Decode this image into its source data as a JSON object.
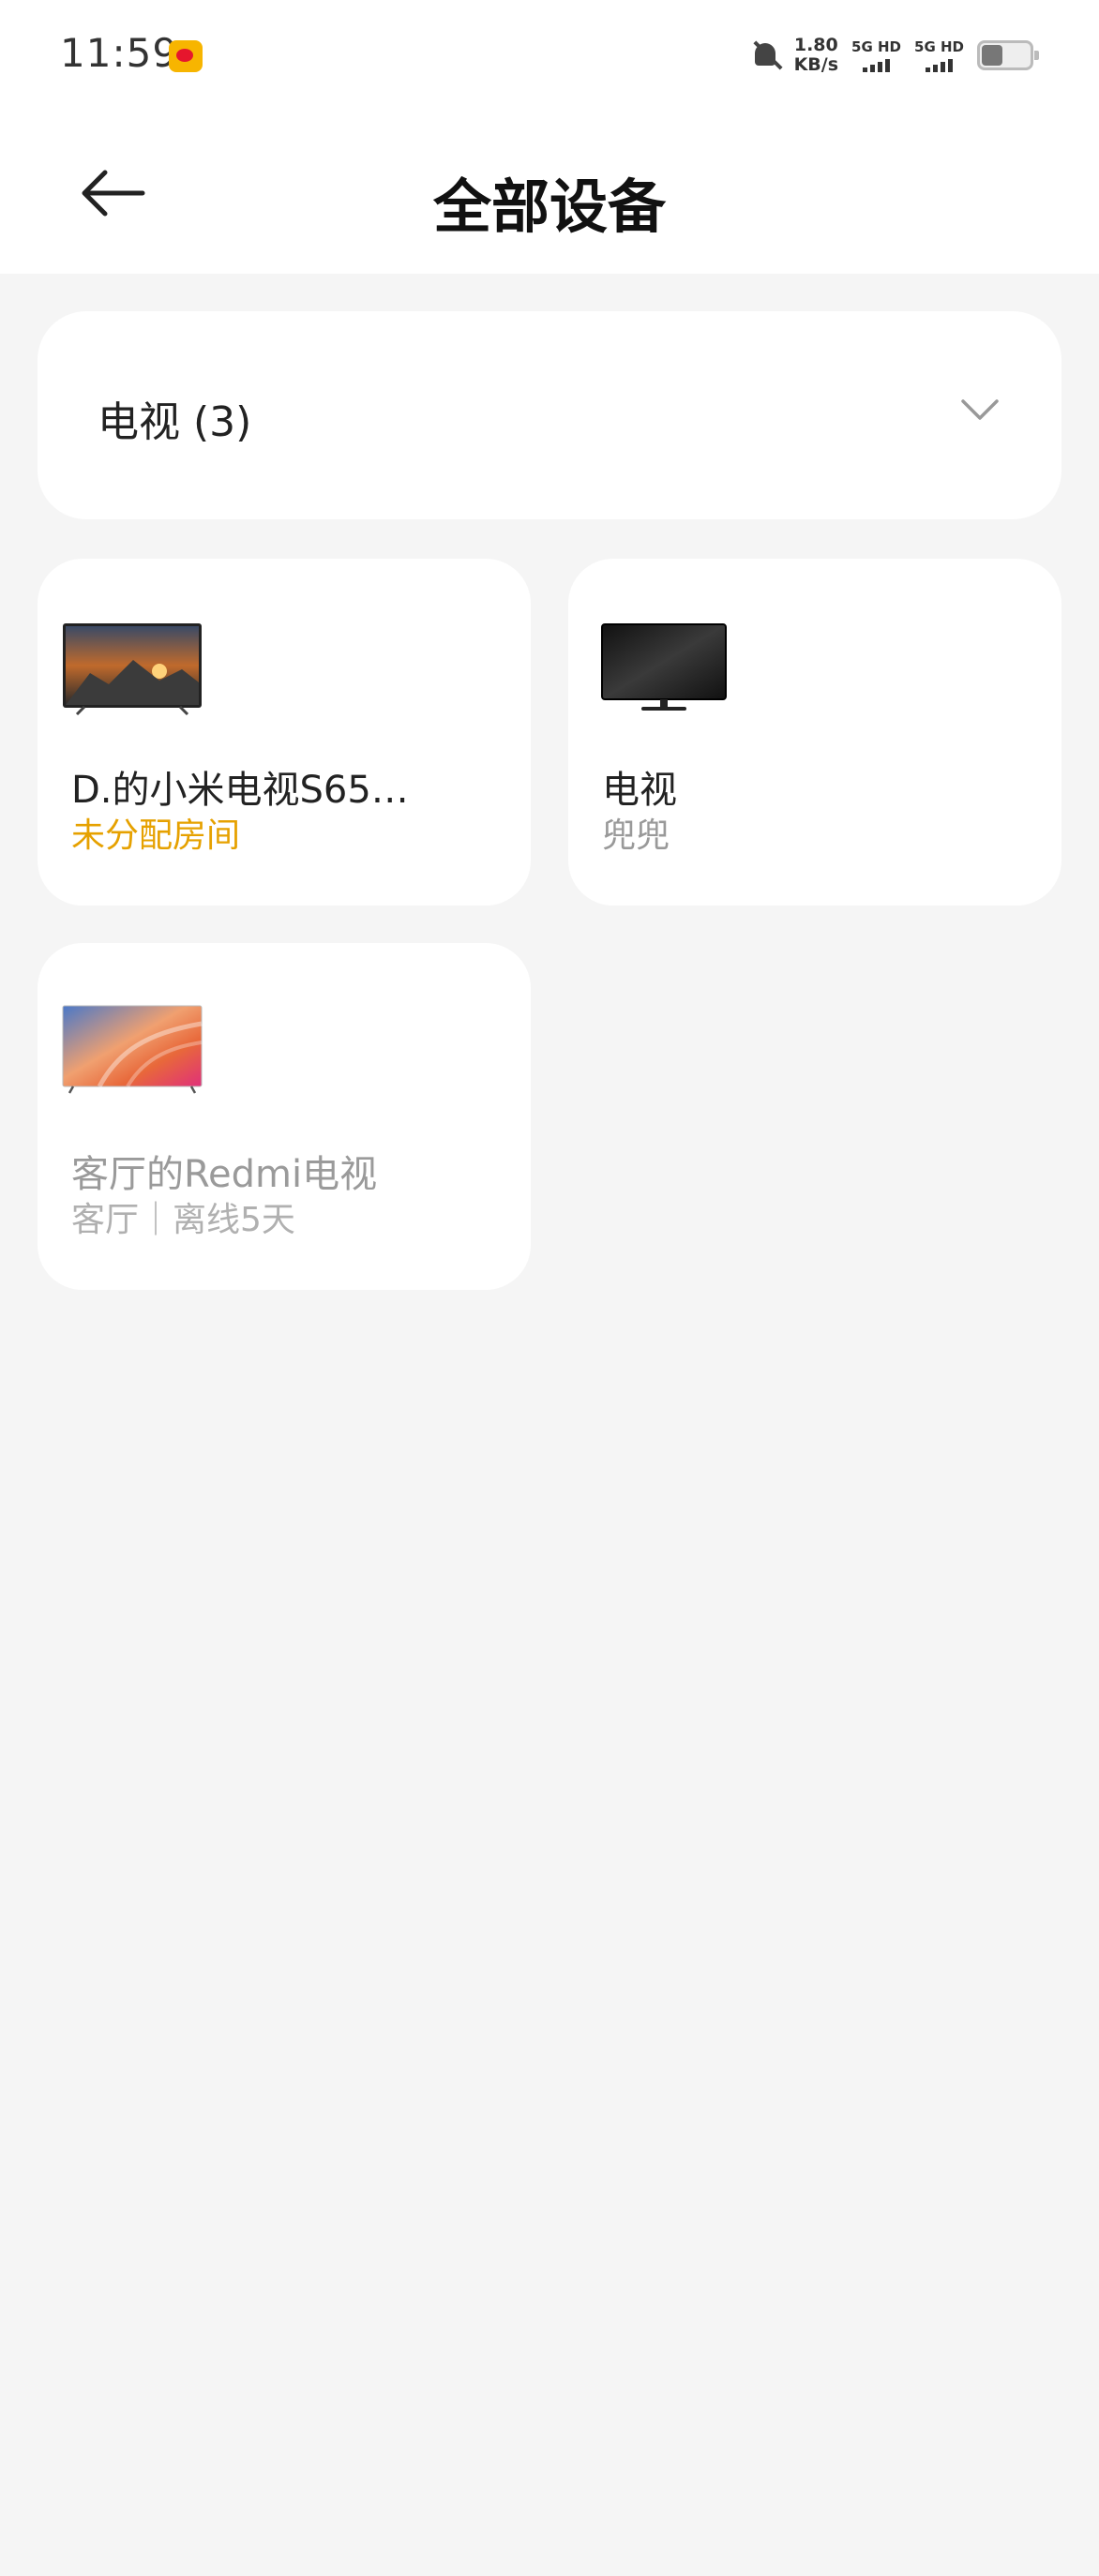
{
  "status_bar": {
    "time": "11:59",
    "net_speed_value": "1.80",
    "net_speed_unit": "KB/s",
    "sim1": "5G HD",
    "sim2": "5G HD",
    "icons": [
      "weibo-icon",
      "bell-muted-icon",
      "signal-icon",
      "battery-icon"
    ]
  },
  "header": {
    "title": "全部设备",
    "back_icon": "arrow-left-icon"
  },
  "filter": {
    "label": "电视 (3)",
    "icon": "chevron-down-icon"
  },
  "devices": [
    {
      "name": "D.的小米电视S65…",
      "subtitle": "未分配房间",
      "status": "unassigned",
      "icon": "tv-landscape-icon"
    },
    {
      "name": "电视",
      "subtitle": "兜兜",
      "status": "online",
      "icon": "tv-black-icon"
    },
    {
      "name": "客厅的Redmi电视",
      "subtitle": "客厅｜离线5天",
      "status": "offline",
      "icon": "tv-colorful-icon"
    }
  ],
  "colors": {
    "background": "#f5f5f5",
    "card": "#ffffff",
    "accent_amber": "#e6a100",
    "muted_text": "#999999"
  }
}
